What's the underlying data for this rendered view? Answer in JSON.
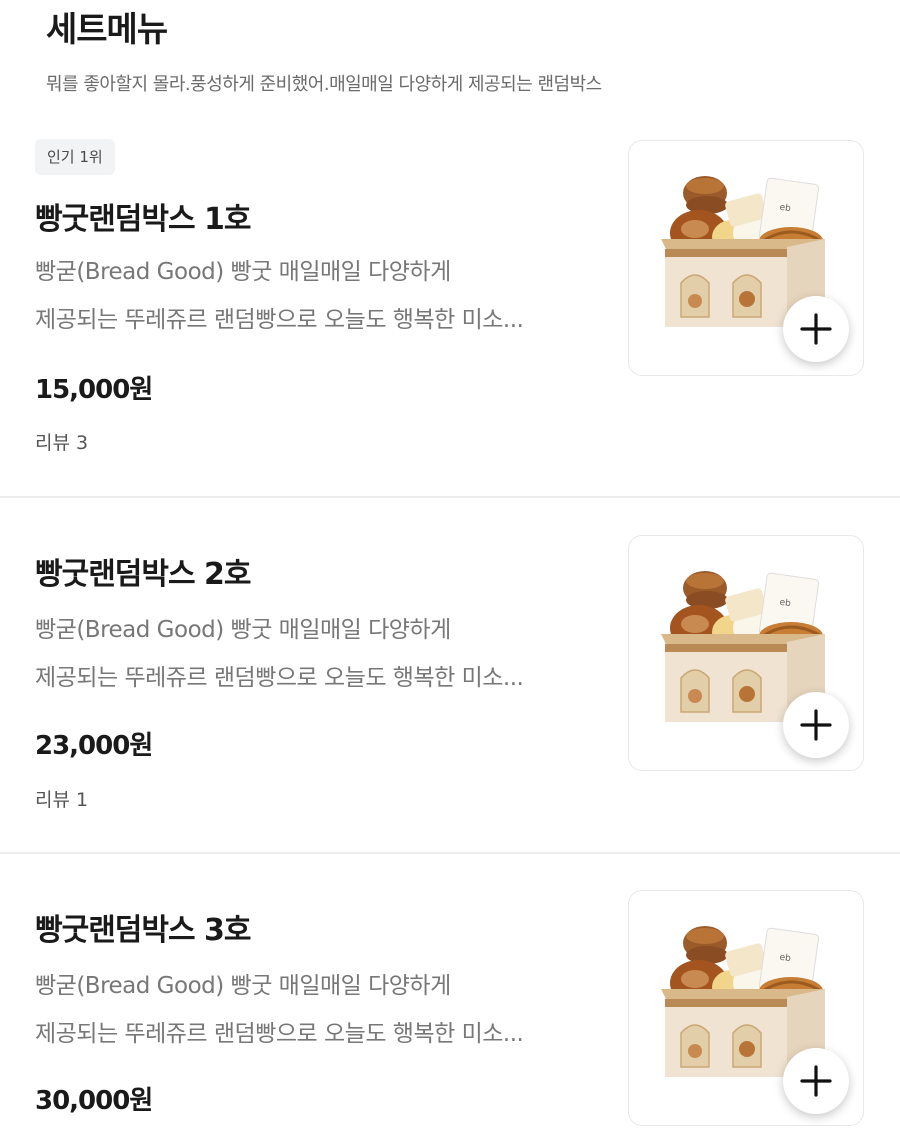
{
  "section": {
    "title": "세트메뉴",
    "subtitle": "뭐를 좋아할지 몰라.풍성하게 준비했어.매일매일 다양하게 제공되는 랜덤박스"
  },
  "items": [
    {
      "badge": "인기 1위",
      "name": "빵굿랜덤박스 1호",
      "desc_line1": "빵굳(Bread Good) 빵굿 매일매일 다양하게",
      "desc_line2": "제공되는 뚜레쥬르 랜덤빵으로 오늘도 행복한 미소...",
      "price": "15,000원",
      "reviews": "리뷰 3",
      "image_icon": "bread-box-image",
      "add_icon": "plus-icon"
    },
    {
      "badge": "",
      "name": "빵굿랜덤박스 2호",
      "desc_line1": "빵굳(Bread Good) 빵굿 매일매일 다양하게",
      "desc_line2": "제공되는 뚜레쥬르 랜덤빵으로 오늘도 행복한 미소...",
      "price": "23,000원",
      "reviews": "리뷰 1",
      "image_icon": "bread-box-image",
      "add_icon": "plus-icon"
    },
    {
      "badge": "",
      "name": "빵굿랜덤박스 3호",
      "desc_line1": "빵굳(Bread Good) 빵굿 매일매일 다양하게",
      "desc_line2": "제공되는 뚜레쥬르 랜덤빵으로 오늘도 행복한 미소...",
      "price": "30,000원",
      "reviews": "",
      "image_icon": "bread-box-image",
      "add_icon": "plus-icon"
    }
  ],
  "colors": {
    "text_primary": "#1a1a1a",
    "text_secondary": "#777777",
    "badge_bg": "#f2f3f5",
    "divider": "#ededed",
    "box_cream": "#efe4d2",
    "box_tan": "#b98a55"
  }
}
